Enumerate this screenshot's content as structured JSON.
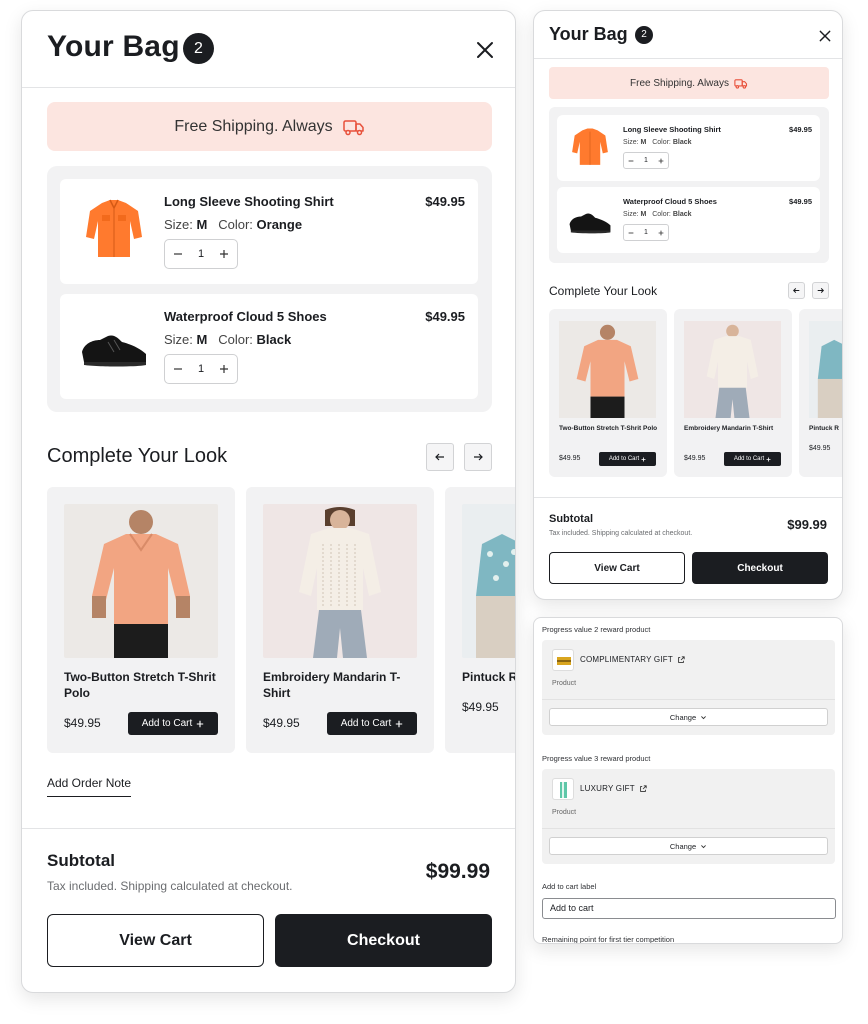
{
  "bag": {
    "title": "Your Bag",
    "count": "2",
    "shipping_banner": "Free Shipping. Always",
    "items": [
      {
        "name": "Long Sleeve Shooting Shirt",
        "price": "$49.95",
        "size_label": "Size:",
        "size": "M",
        "color_label": "Color:",
        "color": "Orange",
        "qty": "1"
      },
      {
        "name": "Waterproof Cloud 5 Shoes",
        "price": "$49.95",
        "size_label": "Size:",
        "size": "M",
        "color_label": "Color:",
        "color": "Black",
        "qty": "1"
      }
    ],
    "items_small_colors": [
      "Black",
      "Black"
    ],
    "look_title": "Complete Your Look",
    "products": [
      {
        "name": "Two-Button Stretch T-Shrit Polo",
        "price": "$49.95",
        "button": "Add to Cart"
      },
      {
        "name": "Embroidery Mandarin T-Shirt",
        "price": "$49.95",
        "button": "Add to Cart"
      },
      {
        "name": "Pintuck R",
        "price": "$49.95"
      }
    ],
    "order_note": "Add Order Note",
    "subtotal_label": "Subtotal",
    "subtotal_note": "Tax included. Shipping calculated at checkout.",
    "subtotal_value": "$99.99",
    "view_cart": "View Cart",
    "checkout": "Checkout"
  },
  "settings": {
    "rewards": [
      {
        "label": "Progress value 2 reward product",
        "product": "COMPLIMENTARY GIFT",
        "type": "Product",
        "change": "Change"
      },
      {
        "label": "Progress value 3 reward product",
        "product": "LUXURY GIFT",
        "type": "Product",
        "change": "Change"
      }
    ],
    "add_to_cart_label": "Add to cart label",
    "add_to_cart_value": "Add to cart",
    "remaining_label": "Remaining point for first tier competition"
  },
  "colors": {
    "accent": "#1b1d21",
    "shipping_bg": "#fce5e0",
    "truck": "#e8503a",
    "panel_bg": "#f2f2f3"
  },
  "icons": [
    "close-icon",
    "truck-icon",
    "minus-icon",
    "plus-icon",
    "arrow-left-icon",
    "arrow-right-icon",
    "external-link-icon",
    "chevron-down-icon"
  ]
}
